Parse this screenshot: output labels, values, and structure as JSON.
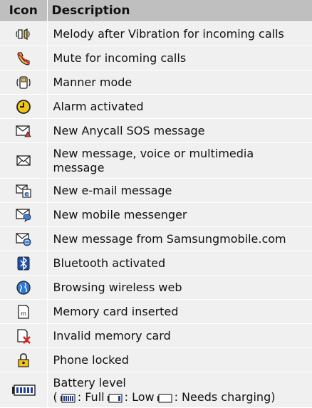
{
  "header": {
    "icon": "Icon",
    "description": "Description"
  },
  "rows": [
    {
      "icon": "melody-after-vibration-icon",
      "text": "Melody after Vibration for incoming calls"
    },
    {
      "icon": "mute-icon",
      "text": "Mute for incoming calls"
    },
    {
      "icon": "manner-mode-icon",
      "text": "Manner mode"
    },
    {
      "icon": "alarm-icon",
      "text": "Alarm activated"
    },
    {
      "icon": "sos-message-icon",
      "text": "New Anycall SOS message"
    },
    {
      "icon": "new-message-icon",
      "text": "New message, voice or multimedia message"
    },
    {
      "icon": "email-icon",
      "text": "New e-mail message"
    },
    {
      "icon": "mobile-messenger-icon",
      "text": "New mobile messenger"
    },
    {
      "icon": "samsungmobile-message-icon",
      "text": "New message from Samsungmobile.com"
    },
    {
      "icon": "bluetooth-icon",
      "text": "Bluetooth activated"
    },
    {
      "icon": "web-browsing-icon",
      "text": "Browsing wireless web"
    },
    {
      "icon": "memory-card-icon",
      "text": "Memory card inserted"
    },
    {
      "icon": "invalid-memory-card-icon",
      "text": "Invalid memory card"
    },
    {
      "icon": "lock-icon",
      "text": "Phone locked"
    }
  ],
  "battery": {
    "icon": "battery-icon",
    "title": "Battery level",
    "open_paren": "(",
    "full_label": ": Full",
    "low_label": ": Low",
    "charge_label": ": Needs charging)"
  }
}
